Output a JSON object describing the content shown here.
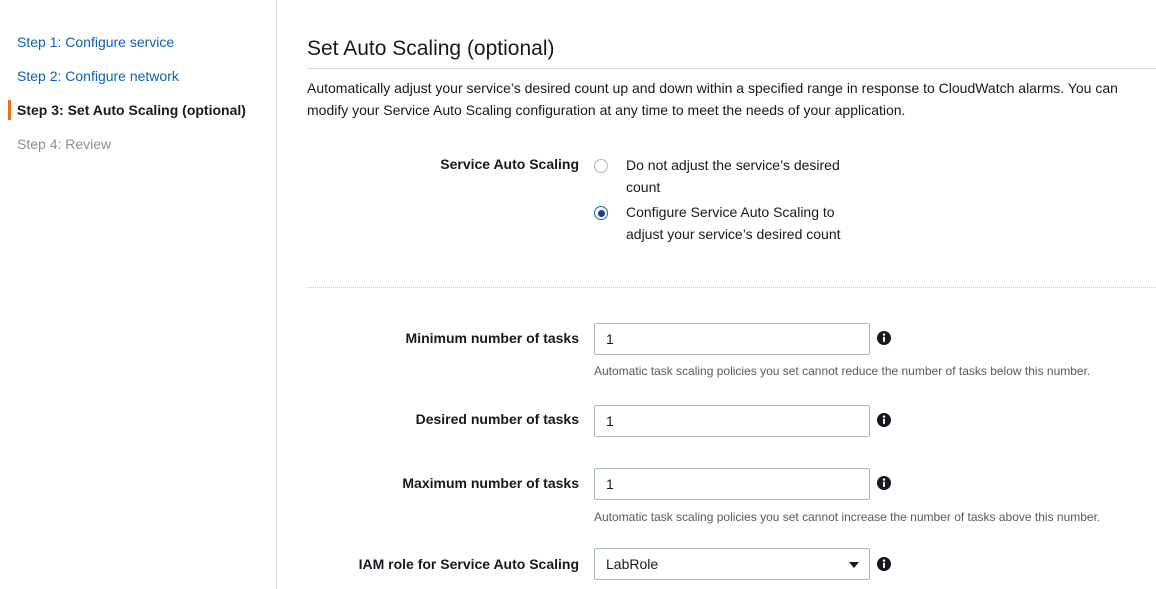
{
  "sidebar": {
    "steps": [
      {
        "label": "Step 1: Configure service",
        "state": "link"
      },
      {
        "label": "Step 2: Configure network",
        "state": "link"
      },
      {
        "label": "Step 3: Set Auto Scaling (optional)",
        "state": "active"
      },
      {
        "label": "Step 4: Review",
        "state": "disabled"
      }
    ]
  },
  "main": {
    "title": "Set Auto Scaling (optional)",
    "description": "Automatically adjust your service’s desired count up and down within a specified range in response to CloudWatch alarms. You can modify your Service Auto Scaling configuration at any time to meet the needs of your application.",
    "service_auto_scaling": {
      "label": "Service Auto Scaling",
      "options": [
        {
          "label": "Do not adjust the service’s desired count",
          "selected": false
        },
        {
          "label": "Configure Service Auto Scaling to adjust your service’s desired count",
          "selected": true
        }
      ]
    },
    "minimum_tasks": {
      "label": "Minimum number of tasks",
      "value": "1",
      "help": "Automatic task scaling policies you set cannot reduce the number of tasks below this number."
    },
    "desired_tasks": {
      "label": "Desired number of tasks",
      "value": "1"
    },
    "maximum_tasks": {
      "label": "Maximum number of tasks",
      "value": "1",
      "help": "Automatic task scaling policies you set cannot increase the number of tasks above this number."
    },
    "iam_role": {
      "label": "IAM role for Service Auto Scaling",
      "value": "LabRole"
    }
  },
  "colors": {
    "accent_orange": "#ec7211",
    "link_blue": "#0b5ebd",
    "radio_selected": "#1e38a0"
  },
  "icons": {
    "info": "info-circle-icon",
    "dropdown": "caret-down-icon"
  }
}
